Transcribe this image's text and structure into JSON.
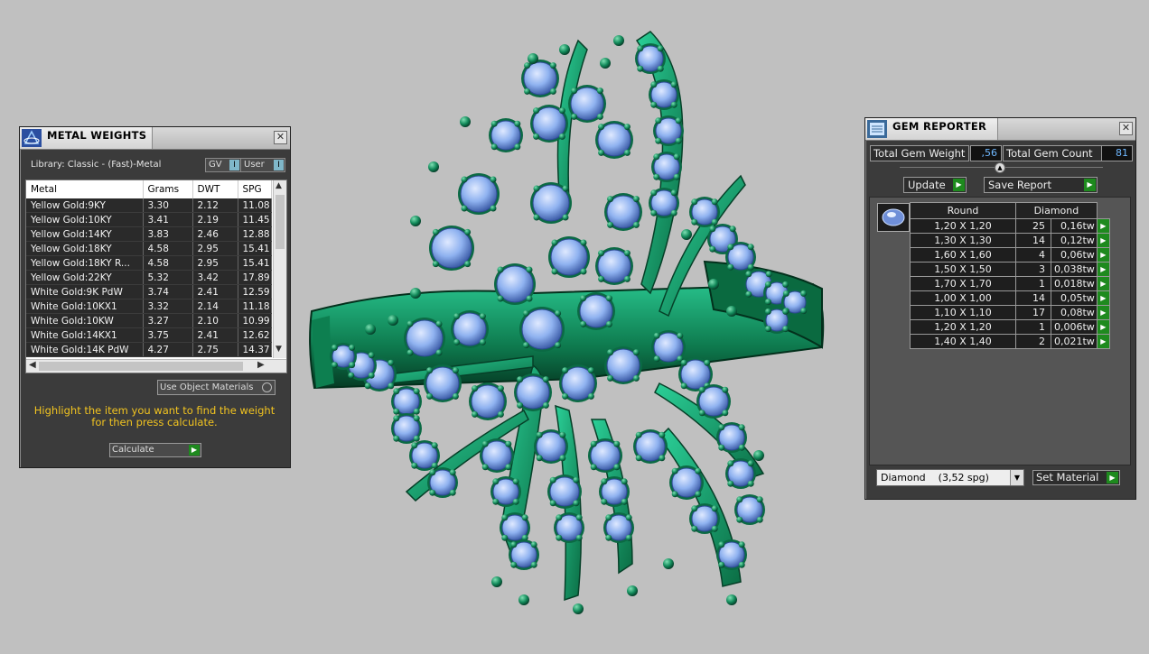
{
  "metal_weights": {
    "title": "METAL WEIGHTS",
    "library_label": "Library: Classic - (Fast)-Metal",
    "gv_label": "GV",
    "user_label": "User",
    "columns": [
      "Metal",
      "Grams",
      "DWT",
      "SPG"
    ],
    "rows": [
      [
        "Yellow Gold:9KY",
        "3.30",
        "2.12",
        "11.08"
      ],
      [
        "Yellow Gold:10KY",
        "3.41",
        "2.19",
        "11.45"
      ],
      [
        "Yellow Gold:14KY",
        "3.83",
        "2.46",
        "12.88"
      ],
      [
        "Yellow Gold:18KY",
        "4.58",
        "2.95",
        "15.41"
      ],
      [
        "Yellow Gold:18KY R...",
        "4.58",
        "2.95",
        "15.41"
      ],
      [
        "Yellow Gold:22KY",
        "5.32",
        "3.42",
        "17.89"
      ],
      [
        "White Gold:9K PdW",
        "3.74",
        "2.41",
        "12.59"
      ],
      [
        "White Gold:10KX1",
        "3.32",
        "2.14",
        "11.18"
      ],
      [
        "White Gold:10KW",
        "3.27",
        "2.10",
        "10.99"
      ],
      [
        "White Gold:14KX1",
        "3.75",
        "2.41",
        "12.62"
      ],
      [
        "White Gold:14K PdW",
        "4.27",
        "2.75",
        "14.37"
      ]
    ],
    "use_object_materials": "Use Object Materials",
    "hint": "Highlight the item you want to find the weight for then press calculate.",
    "calculate_label": "Calculate"
  },
  "gem_reporter": {
    "title": "GEM REPORTER",
    "total_weight_label": "Total Gem Weight",
    "total_weight_value": ",56",
    "total_count_label": "Total Gem Count",
    "total_count_value": "81",
    "update_label": "Update",
    "save_report_label": "Save Report",
    "columns": [
      "Round",
      "Diamond"
    ],
    "rows": [
      [
        "1,20 X 1,20",
        "25",
        "0,16tw"
      ],
      [
        "1,30 X 1,30",
        "14",
        "0,12tw"
      ],
      [
        "1,60 X 1,60",
        "4",
        "0,06tw"
      ],
      [
        "1,50 X 1,50",
        "3",
        "0,038tw"
      ],
      [
        "1,70 X 1,70",
        "1",
        "0,018tw"
      ],
      [
        "1,00 X 1,00",
        "14",
        "0,05tw"
      ],
      [
        "1,10 X 1,10",
        "17",
        "0,08tw"
      ],
      [
        "1,20 X 1,20",
        "1",
        "0,006tw"
      ],
      [
        "1,40 X 1,40",
        "2",
        "0,021tw"
      ]
    ],
    "material_select": "Diamond    (3,52 spg)",
    "set_material_label": "Set Material"
  },
  "colors": {
    "viewport_bg": "#c0c0c0",
    "metal": "#17a06a",
    "gem": "#8fb2f0",
    "hint_text": "#f2c420",
    "play_button": "#1e8a1e"
  }
}
